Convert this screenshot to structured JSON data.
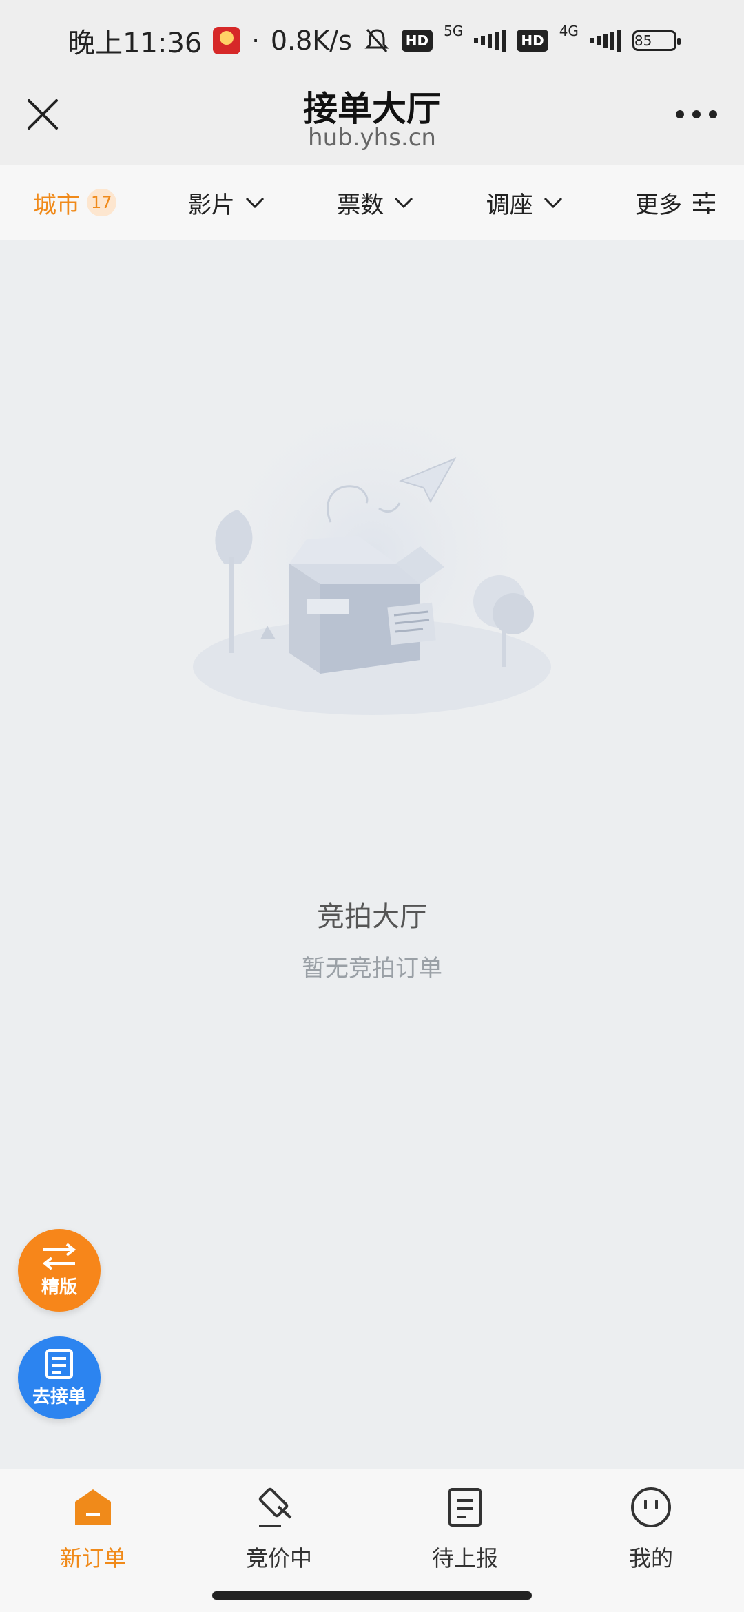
{
  "status_bar": {
    "time": "晚上11:36",
    "separator": "·",
    "speed": "0.8K/s",
    "hd_label": "HD",
    "net1": "5G",
    "net2": "4G",
    "battery": "85"
  },
  "header": {
    "title": "接单大厅",
    "subtitle": "hub.yhs.cn"
  },
  "filters": {
    "city_label": "城市",
    "city_count": "17",
    "film_label": "影片",
    "tickets_label": "票数",
    "seat_label": "调座",
    "more_label": "更多"
  },
  "empty_state": {
    "title": "竞拍大厅",
    "subtitle": "暂无竞拍订单"
  },
  "fabs": {
    "switch_label": "精版",
    "take_orders_label": "去接单"
  },
  "tabs": [
    {
      "label": "新订单",
      "icon": "home-icon",
      "active": true
    },
    {
      "label": "竞价中",
      "icon": "gavel-icon",
      "active": false
    },
    {
      "label": "待上报",
      "icon": "document-icon",
      "active": false
    },
    {
      "label": "我的",
      "icon": "face-icon",
      "active": false
    }
  ],
  "colors": {
    "accent": "#f08a1a",
    "fab_orange": "#f7861a",
    "fab_blue": "#2c84f0"
  }
}
